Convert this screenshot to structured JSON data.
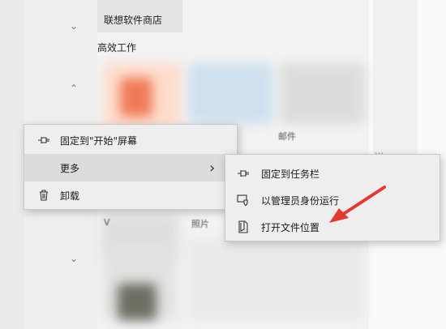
{
  "store": {
    "label": "联想软件商店"
  },
  "groups": {
    "efficient_work": "高效工作"
  },
  "tile_fragments": {
    "mail_partial": "邮件",
    "right_partial": "…",
    "bottom_left": "V",
    "bottom_mid": "照片"
  },
  "context_menu": {
    "items": [
      {
        "label": "固定到\"开始\"屏幕",
        "icon": "pin-icon"
      },
      {
        "label": "更多",
        "icon": "",
        "submenu_arrow": "›"
      },
      {
        "label": "卸载",
        "icon": "trash-icon"
      }
    ]
  },
  "submenu": {
    "items": [
      {
        "label": "固定到任务栏",
        "icon": "pin-icon"
      },
      {
        "label": "以管理员身份运行",
        "icon": "shield-run-icon"
      },
      {
        "label": "打开文件位置",
        "icon": "file-location-icon"
      }
    ]
  },
  "colors": {
    "menu_bg": "#eeeeee",
    "hover_bg": "#dcdcdc",
    "annotation_arrow": "#e23a2e"
  }
}
